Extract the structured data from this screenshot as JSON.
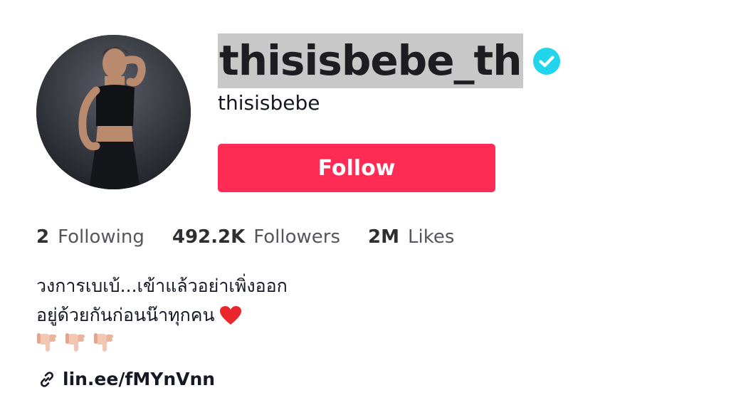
{
  "profile": {
    "username": "thisisbebe_th",
    "nickname": "thisisbebe",
    "verified": true,
    "follow_label": "Follow"
  },
  "stats": [
    {
      "value": "2",
      "label": "Following"
    },
    {
      "value": "492.2K",
      "label": "Followers"
    },
    {
      "value": "2M",
      "label": "Likes"
    }
  ],
  "bio": {
    "line1": "วงการเบเบ้...เข้าแล้วอย่าเพิ่งออก",
    "line2": "อยู่ด้วยกันก่อนน๊าทุกคน",
    "line2_emoji": "heart-icon",
    "line3_emoji": [
      "pointing-down-hand-icon",
      "pointing-down-hand-icon",
      "pointing-down-hand-icon"
    ]
  },
  "link": {
    "text": "lin.ee/fMYnVnn",
    "icon": "link-icon"
  },
  "colors": {
    "accent": "#fe2c55",
    "verified": "#20d5ec",
    "heart": "#e8262b"
  }
}
